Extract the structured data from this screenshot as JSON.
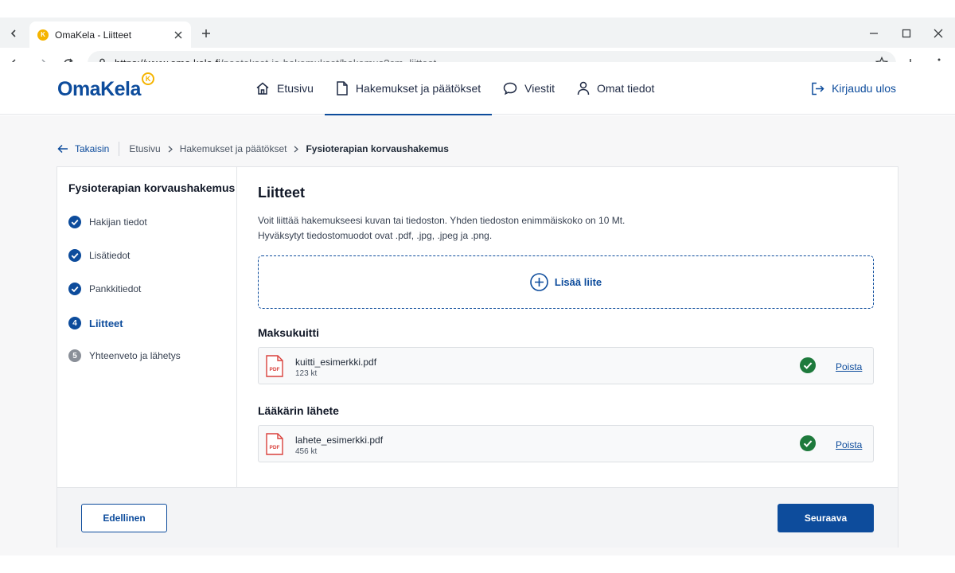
{
  "browser": {
    "tab_title": "OmaKela - Liitteet",
    "url_host": "https://www.oma.kela.fi",
    "url_path": "/paatokset-ja-hakemukset/hakemus?cm=liitteet"
  },
  "site": {
    "logo": "OmaKela",
    "nav": [
      {
        "label": "Etusivu",
        "icon": "home-icon"
      },
      {
        "label": "Hakemukset ja päätökset",
        "icon": "document-icon"
      },
      {
        "label": "Viestit",
        "icon": "chat-icon"
      },
      {
        "label": "Omat tiedot",
        "icon": "user-icon"
      }
    ],
    "active_nav": "Hakemukset ja päätökset",
    "logout": "Kirjaudu ulos"
  },
  "breadcrumb": {
    "back": "Takaisin",
    "items": [
      "Etusivu",
      "Hakemukset ja päätökset"
    ],
    "current": "Fysioterapian korvaushakemus"
  },
  "sidebar": {
    "title": "Fysioterapian korvaushakemus",
    "steps": [
      {
        "label": "Hakijan tiedot",
        "status": "done"
      },
      {
        "label": "Lisätiedot",
        "status": "done"
      },
      {
        "label": "Pankkitiedot",
        "status": "done"
      },
      {
        "label": "Liitteet",
        "status": "active",
        "number": "4"
      },
      {
        "label": "Yhteenveto ja lähetys",
        "status": "pending",
        "number": "5"
      }
    ]
  },
  "content": {
    "title": "Liitteet",
    "intro_line1": "Voit liittää hakemukseesi kuvan tai tiedoston. Yhden tiedoston enimmäiskoko on 10 Mt.",
    "intro_line2": "Hyväksytyt tiedostomuodot ovat .pdf, .jpg, .jpeg ja .png.",
    "add_label": "Lisää liite",
    "sections": [
      {
        "title": "Maksukuitti",
        "file": {
          "name": "kuitti_esimerkki.pdf",
          "size": "123 kt",
          "type_label": "PDF",
          "remove": "Poista"
        }
      },
      {
        "title": "Lääkärin lähete",
        "file": {
          "name": "lahete_esimerkki.pdf",
          "size": "456 kt",
          "type_label": "PDF",
          "remove": "Poista"
        }
      }
    ]
  },
  "footer": {
    "prev": "Edellinen",
    "next": "Seuraava"
  },
  "colors": {
    "brand": "#0d4c9c",
    "accent": "#f5b400",
    "success": "#1e7a3c",
    "pdf_red": "#d9413c"
  }
}
